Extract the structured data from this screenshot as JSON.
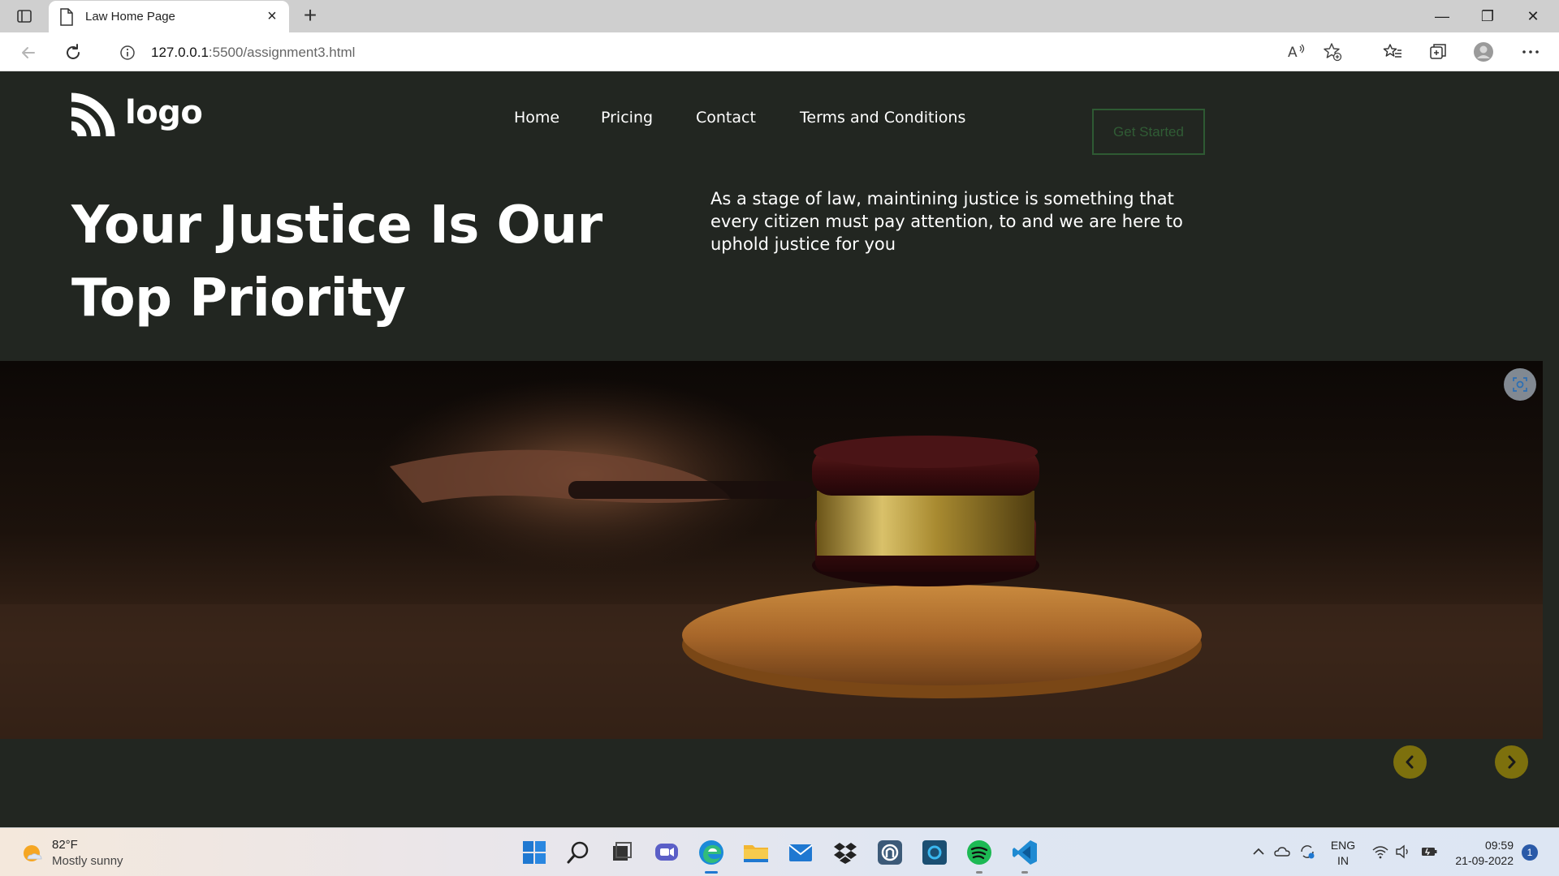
{
  "browser": {
    "tab_title": "Law Home Page",
    "tab_close": "×",
    "new_tab": "+",
    "url_host": "127.0.0.1",
    "url_path": ":5500/assignment3.html",
    "window_controls": {
      "minimize": "—",
      "restore": "❐",
      "close": "✕"
    }
  },
  "site": {
    "logo_text": "logo",
    "nav": [
      "Home",
      "Pricing",
      "Contact",
      "Terms and Conditions"
    ],
    "cta": "Get Started",
    "hero_title_line1": "Your Justice Is Our",
    "hero_title_line2": "Top Priority",
    "hero_text": "As a stage of law, maintining justice is something that every citizen must pay attention, to and we are here to uphold justice for you",
    "hero_image_icon": "gavel-image",
    "carousel_prev_icon": "chevron-left-icon",
    "carousel_next_icon": "chevron-right-icon",
    "colors": {
      "page_bg": "#222621",
      "cta_border": "#2e5a33",
      "carousel_btn": "#7d700d"
    }
  },
  "taskbar": {
    "weather_temp": "82°F",
    "weather_cond": "Mostly sunny",
    "apps": [
      "start-icon",
      "search-icon",
      "task-view-icon",
      "chat-icon",
      "edge-icon",
      "file-explorer-icon",
      "mail-icon",
      "dropbox-icon",
      "app-icon",
      "cortana-icon",
      "spotify-icon",
      "vscode-icon"
    ],
    "lang_line1": "ENG",
    "lang_line2": "IN",
    "time": "09:59",
    "date": "21-09-2022",
    "notifications": "1"
  }
}
